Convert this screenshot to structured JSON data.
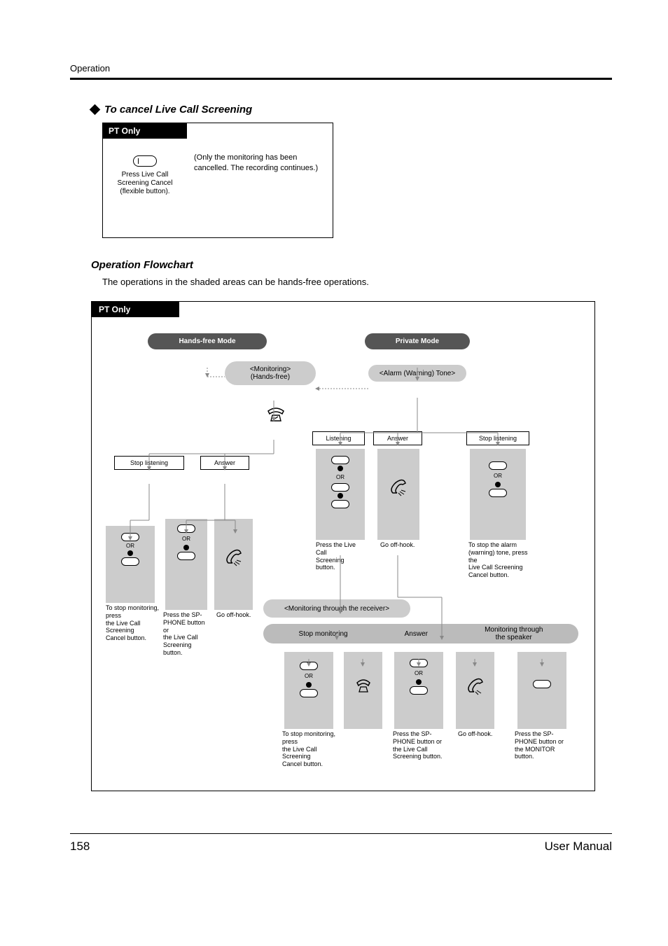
{
  "header": {
    "section": "Operation"
  },
  "cancel": {
    "heading": "To cancel Live Call Screening",
    "pt_label": "PT Only",
    "button_label": "Press Live Call\nScreening Cancel\n(flexible button).",
    "note": "(Only the monitoring has been cancelled.\nThe recording continues.)"
  },
  "flowchart": {
    "heading": "Operation Flowchart",
    "desc": "The operations in the shaded areas can be hands-free operations.",
    "pt_label": "PT Only",
    "mode_hands_free": "Hands-free Mode",
    "mode_private": "Private Mode",
    "state_monitoring": "<Monitoring>\n(Hands-free)",
    "state_alarm": "<Alarm (Warning) Tone>",
    "action_stop_listening": "Stop listening",
    "action_answer": "Answer",
    "action_listening": "Listening",
    "state_monitor_receiver": "<Monitoring through the receiver>",
    "bubble_stop_monitoring": "Stop monitoring",
    "bubble_answer": "Answer",
    "bubble_monitor_sp": "Monitoring through\nthe speaker",
    "captions": {
      "to_stop": "To stop monitoring, press\nthe Live Call Screening\nCancel button.",
      "sp_phone_or_lcs": "Press the SP-\nPHONE button or\nthe Live Call\nScreening button.",
      "off_hook": "Go off-hook.",
      "press_lcs": "Press the Live Call\nScreening button.",
      "stop_alarm": "To stop the alarm\n(warning) tone, press the\nLive Call Screening\nCancel button.",
      "sp_or_monitor": "Press the SP-\nPHONE button or\nthe MONITOR\nbutton."
    }
  },
  "footer": {
    "page": "158",
    "manual": "User Manual"
  }
}
